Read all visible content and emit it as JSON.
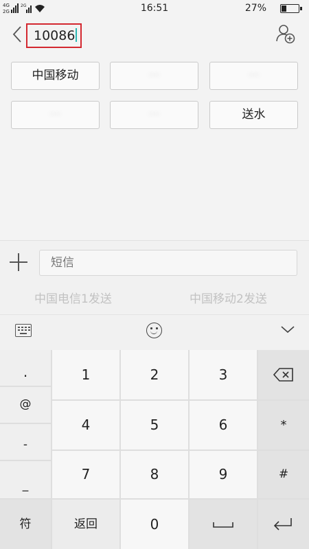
{
  "status_bar": {
    "signal_labels": [
      "4G",
      "2G",
      "2G"
    ],
    "time": "16:51",
    "battery_text": "27%",
    "battery_level": 0.27
  },
  "header": {
    "back_icon": "chevron-left-icon",
    "recipient": "10086",
    "add_contact_icon": "add-contact-icon",
    "highlight_color": "#d3272f"
  },
  "chips": [
    {
      "label": "中国移动",
      "blurred": false
    },
    {
      "label": "···",
      "blurred": true
    },
    {
      "label": "···",
      "blurred": true
    },
    {
      "label": "···",
      "blurred": true
    },
    {
      "label": "···",
      "blurred": true
    },
    {
      "label": "送水",
      "blurred": false
    }
  ],
  "compose": {
    "placeholder": "短信",
    "send_sim1": "中国电信1发送",
    "send_sim2": "中国移动2发送"
  },
  "keyboard": {
    "symbols": [
      ".",
      "@",
      "-",
      "_"
    ],
    "digits": [
      "1",
      "2",
      "3",
      "4",
      "5",
      "6",
      "7",
      "8",
      "9",
      "0"
    ],
    "right_keys": [
      "*",
      "#"
    ],
    "fn_symbol": "符",
    "fn_back": "返回",
    "icons": [
      "keyboard-icon",
      "emoji-icon",
      "collapse-icon",
      "backspace-icon",
      "space-icon",
      "enter-icon"
    ]
  }
}
